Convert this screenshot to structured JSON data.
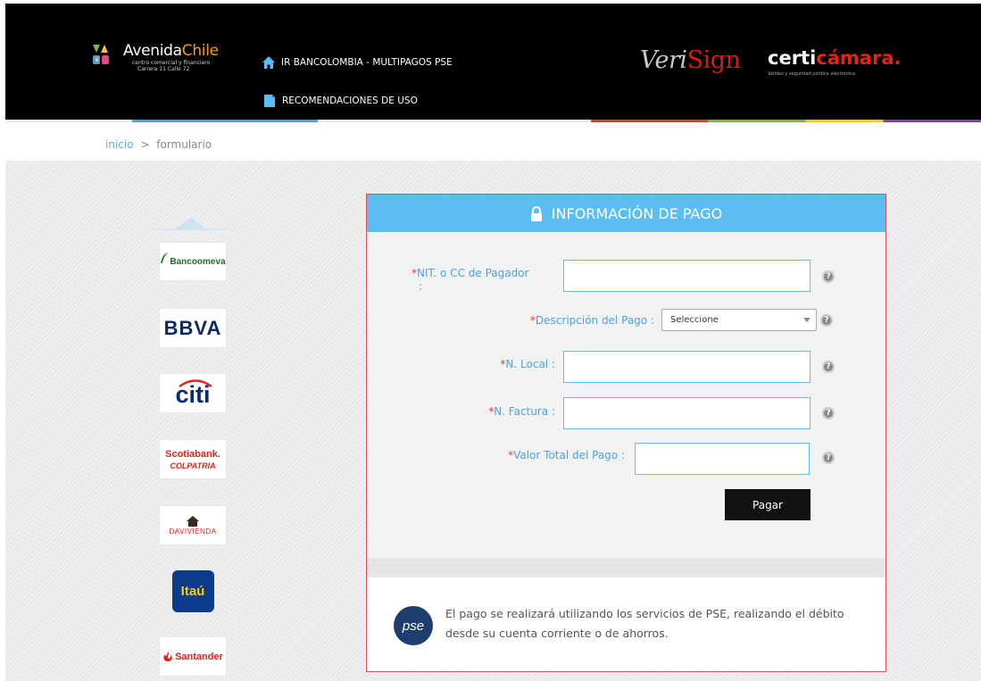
{
  "header": {
    "brand": {
      "name_part1": "Avenida",
      "name_part2": "Chile",
      "subtitle_line1": "centro comercial y financiero",
      "subtitle_line2": "Carrera 11 Calle 72"
    },
    "nav": [
      {
        "label": "IR BANCOLOMBIA - MULTIPAGOS PSE",
        "icon": "home-icon"
      },
      {
        "label": "RECOMENDACIONES DE USO",
        "icon": "document-icon"
      }
    ],
    "partners": {
      "verisign_v": "V",
      "verisign_eri": "eri",
      "verisign_sign": "Sign",
      "certi_part1": "certi",
      "certi_part2": "cámara.",
      "certi_tagline": "Validez y seguridad jurídica electrónica"
    }
  },
  "breadcrumb": {
    "home": "inicio",
    "separator": ">",
    "current": "formulario"
  },
  "banks": [
    {
      "name": "Bancoomeva"
    },
    {
      "name": "BBVA"
    },
    {
      "name": "citi"
    },
    {
      "name_line1": "Scotiabank.",
      "name_line2": "COLPATRIA"
    },
    {
      "name": "DAVIVIENDA"
    },
    {
      "name": "Itaú"
    },
    {
      "name": "Santander"
    }
  ],
  "form": {
    "title": "INFORMACIÓN DE PAGO",
    "required_mark": "*",
    "fields": {
      "nit": {
        "label": "NIT. o CC de Pagador",
        "label_suffix": ":",
        "value": ""
      },
      "descripcion": {
        "label": "Descripción del Pago :",
        "selected": "Seleccione"
      },
      "local": {
        "label": "N. Local :",
        "value": ""
      },
      "factura": {
        "label": "N. Factura :",
        "value": ""
      },
      "valor": {
        "label": "Valor Total del Pago :",
        "value": ""
      }
    },
    "help_glyph": "?",
    "submit_label": "Pagar",
    "pse_logo_text": "pse",
    "pse_notice": "El pago se realizará utilizando los servicios de PSE, realizando el débito desde su cuenta corriente o de ahorros."
  },
  "colors": {
    "header_bg": "#000000",
    "card_header": "#5bbdf2",
    "label_blue": "#4aa3df",
    "required_red": "#e53935",
    "card_border": "#e05050",
    "button_bg": "#111111"
  }
}
